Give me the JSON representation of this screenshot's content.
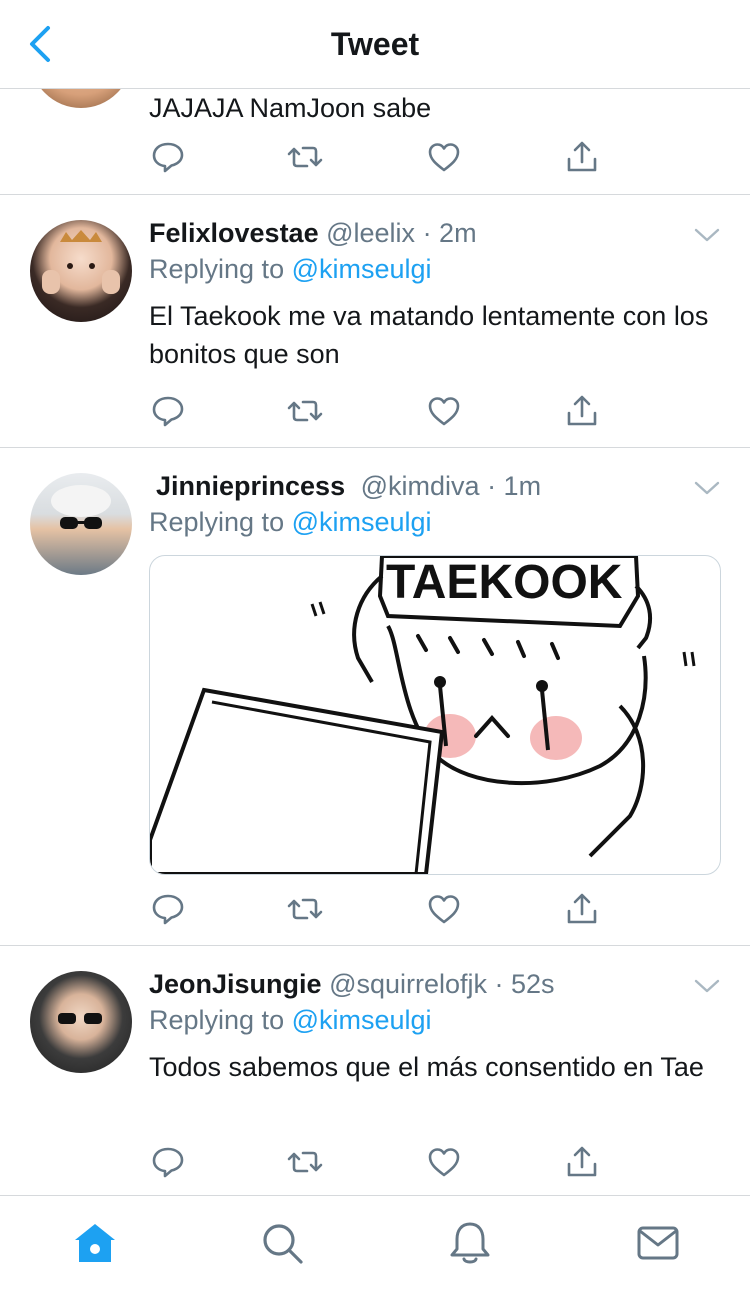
{
  "header": {
    "title": "Tweet",
    "back_icon": "chevron-left-icon",
    "accent": "#1da1f2"
  },
  "tweets": [
    {
      "text": "JAJAJA NamJoon sabe"
    },
    {
      "name": "Felixlovestae",
      "handle": "@leelix",
      "time": "· 2m",
      "replying_prefix": "Replying to",
      "replying_to": "@kimseulgi",
      "text": "El Taekook me va matando lentamente con los bonitos que son"
    },
    {
      "name": "Jinnieprincess",
      "handle": "@kimdiva",
      "time": "· 1m",
      "replying_prefix": "Replying to",
      "replying_to": "@kimseulgi",
      "image_caption": "TAEKOOK"
    },
    {
      "name": "JeonJisungie",
      "handle": "@squirrelofjk",
      "time": "· 52s",
      "replying_prefix": "Replying to",
      "replying_to": "@kimseulgi",
      "text": "Todos sabemos que el más consentido en Tae"
    }
  ],
  "actions": [
    "reply-icon",
    "retweet-icon",
    "like-icon",
    "share-icon"
  ],
  "tabbar": [
    "home-icon",
    "search-icon",
    "notifications-icon",
    "messages-icon"
  ],
  "colors": {
    "text": "#14171a",
    "secondary": "#657786",
    "link": "#1da1f2",
    "divider": "#d6d9dc"
  }
}
